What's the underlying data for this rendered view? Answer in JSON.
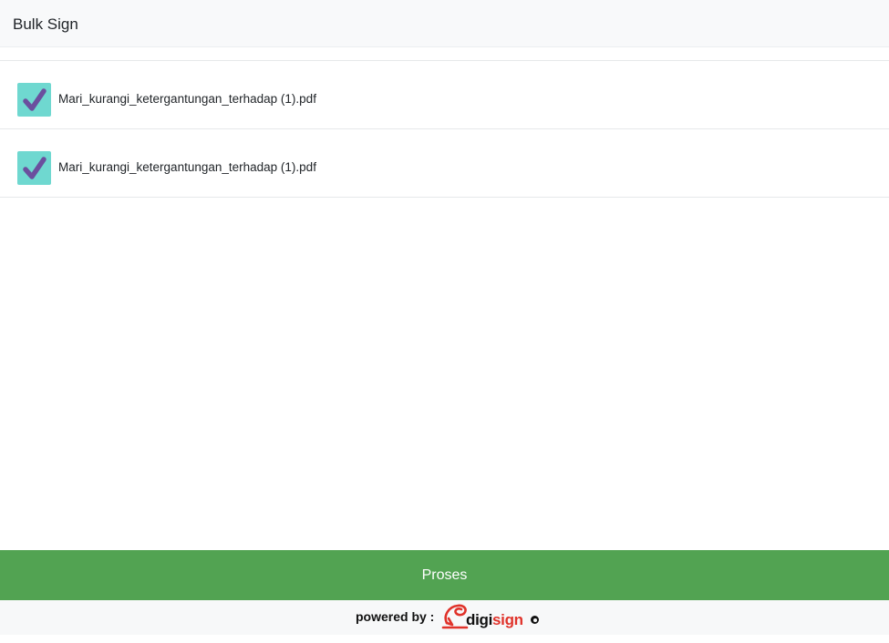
{
  "header": {
    "title": "Bulk Sign"
  },
  "files": [
    {
      "name": "Mari_kurangi_ketergantungan_terhadap (1).pdf",
      "checked": true
    },
    {
      "name": "Mari_kurangi_ketergantungan_terhadap (1).pdf",
      "checked": true
    }
  ],
  "actions": {
    "proses_label": "Proses"
  },
  "footer": {
    "powered_by": "powered by :",
    "brand_digi": "digi",
    "brand_sign": "sign"
  },
  "icons": {
    "checkbox": "checkmark-icon",
    "brand": "digisign-logo-icon"
  },
  "colors": {
    "checkbox_bg": "#6fd8d0",
    "checkmark": "#6b4f9e",
    "proses_button": "#52a352",
    "brand_red": "#e0322a",
    "header_bg": "#f8f9fa"
  }
}
